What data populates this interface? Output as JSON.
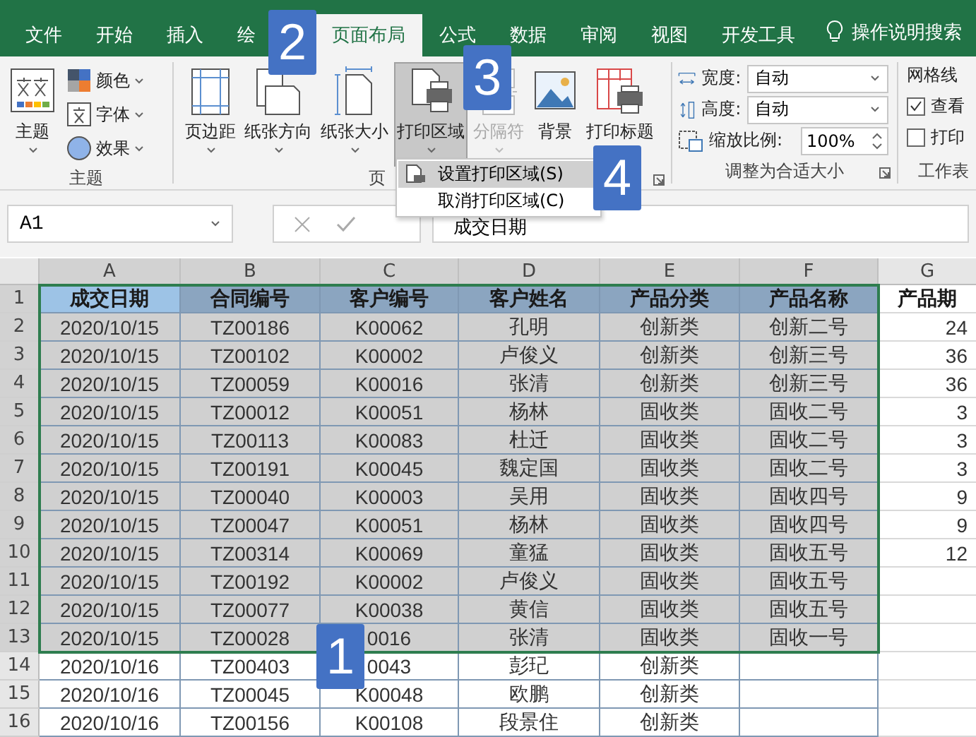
{
  "tabs": [
    {
      "label": "文件",
      "selected": false
    },
    {
      "label": "开始",
      "selected": false
    },
    {
      "label": "插入",
      "selected": false
    },
    {
      "label": "绘",
      "selected": false
    },
    {
      "label": "页面布局",
      "selected": true
    },
    {
      "label": "公式",
      "selected": false
    },
    {
      "label": "数据",
      "selected": false
    },
    {
      "label": "审阅",
      "selected": false
    },
    {
      "label": "视图",
      "selected": false
    },
    {
      "label": "开发工具",
      "selected": false
    }
  ],
  "tell_me": "操作说明搜索",
  "ribbon": {
    "theme_group": {
      "label": "主题",
      "main": "主题",
      "items": [
        "颜色",
        "字体",
        "效果"
      ]
    },
    "page_group": {
      "label": "页",
      "buttons": [
        {
          "label": "页边距",
          "kind": "margins",
          "selected": false,
          "disabled": false,
          "caret": true
        },
        {
          "label": "纸张方向",
          "kind": "orientation",
          "selected": false,
          "disabled": false,
          "caret": true
        },
        {
          "label": "纸张大小",
          "kind": "size",
          "selected": false,
          "disabled": false,
          "caret": true
        },
        {
          "label": "打印区域",
          "kind": "printarea",
          "selected": true,
          "disabled": false,
          "caret": true
        },
        {
          "label": "分隔符",
          "kind": "breaks",
          "selected": false,
          "disabled": true,
          "caret": true
        },
        {
          "label": "背景",
          "kind": "background",
          "selected": false,
          "disabled": false,
          "caret": false
        },
        {
          "label": "打印标题",
          "kind": "titles",
          "selected": false,
          "disabled": false,
          "caret": false
        }
      ]
    },
    "scale_group": {
      "label": "调整为合适大小",
      "width_label": "宽度:",
      "width_value": "自动",
      "height_label": "高度:",
      "height_value": "自动",
      "scale_label": "缩放比例:",
      "scale_value": "100%"
    },
    "sheet_group": {
      "label": "工作表",
      "heading": "网格线",
      "options": [
        {
          "label": "查看",
          "checked": true
        },
        {
          "label": "打印",
          "checked": false
        }
      ]
    }
  },
  "menu": {
    "items": [
      {
        "label": "设置打印区域(S)",
        "selected": true
      },
      {
        "label": "取消打印区域(C)",
        "selected": false
      }
    ]
  },
  "name_box": "A1",
  "formula": "成交日期",
  "columns": [
    {
      "label": "A",
      "selected": true
    },
    {
      "label": "B",
      "selected": true
    },
    {
      "label": "C",
      "selected": true
    },
    {
      "label": "D",
      "selected": true
    },
    {
      "label": "E",
      "selected": true
    },
    {
      "label": "F",
      "selected": true
    },
    {
      "label": "G",
      "selected": false
    }
  ],
  "rows": [
    {
      "number": "1",
      "kind": "header",
      "selected": true,
      "cells": [
        "成交日期",
        "合同编号",
        "客户编号",
        "客户姓名",
        "产品分类",
        "产品名称",
        "产品期"
      ]
    },
    {
      "number": "2",
      "kind": "data",
      "selected": true,
      "cells": [
        "2020/10/15",
        "TZ00186",
        "K00062",
        "孔明",
        "创新类",
        "创新二号",
        "24"
      ]
    },
    {
      "number": "3",
      "kind": "data",
      "selected": true,
      "cells": [
        "2020/10/15",
        "TZ00102",
        "K00002",
        "卢俊义",
        "创新类",
        "创新三号",
        "36"
      ]
    },
    {
      "number": "4",
      "kind": "data",
      "selected": true,
      "cells": [
        "2020/10/15",
        "TZ00059",
        "K00016",
        "张清",
        "创新类",
        "创新三号",
        "36"
      ]
    },
    {
      "number": "5",
      "kind": "data",
      "selected": true,
      "cells": [
        "2020/10/15",
        "TZ00012",
        "K00051",
        "杨林",
        "固收类",
        "固收二号",
        "3"
      ]
    },
    {
      "number": "6",
      "kind": "data",
      "selected": true,
      "cells": [
        "2020/10/15",
        "TZ00113",
        "K00083",
        "杜迁",
        "固收类",
        "固收二号",
        "3"
      ]
    },
    {
      "number": "7",
      "kind": "data",
      "selected": true,
      "cells": [
        "2020/10/15",
        "TZ00191",
        "K00045",
        "魏定国",
        "固收类",
        "固收二号",
        "3"
      ]
    },
    {
      "number": "8",
      "kind": "data",
      "selected": true,
      "cells": [
        "2020/10/15",
        "TZ00040",
        "K00003",
        "吴用",
        "固收类",
        "固收四号",
        "9"
      ]
    },
    {
      "number": "9",
      "kind": "data",
      "selected": true,
      "cells": [
        "2020/10/15",
        "TZ00047",
        "K00051",
        "杨林",
        "固收类",
        "固收四号",
        "9"
      ]
    },
    {
      "number": "10",
      "kind": "data",
      "selected": true,
      "cells": [
        "2020/10/15",
        "TZ00314",
        "K00069",
        "童猛",
        "固收类",
        "固收五号",
        "12"
      ]
    },
    {
      "number": "11",
      "kind": "data",
      "selected": true,
      "cells": [
        "2020/10/15",
        "TZ00192",
        "K00002",
        "卢俊义",
        "固收类",
        "固收五号"
      ]
    },
    {
      "number": "12",
      "kind": "data",
      "selected": true,
      "cells": [
        "2020/10/15",
        "TZ00077",
        "K00038",
        "黄信",
        "固收类",
        "固收五号"
      ]
    },
    {
      "number": "13",
      "kind": "data",
      "selected": true,
      "cells": [
        "2020/10/15",
        "TZ00028",
        "0016",
        "张清",
        "固收类",
        "固收一号"
      ]
    },
    {
      "number": "14",
      "kind": "data",
      "selected": false,
      "cells": [
        "2020/10/16",
        "TZ00403",
        "0043",
        "彭玘",
        "创新类"
      ]
    },
    {
      "number": "15",
      "kind": "data",
      "selected": false,
      "cells": [
        "2020/10/16",
        "TZ00045",
        "K00048",
        "欧鹏",
        "创新类"
      ]
    },
    {
      "number": "16",
      "kind": "data",
      "selected": false,
      "cells": [
        "2020/10/16",
        "TZ00156",
        "K00108",
        "段景住",
        "创新类"
      ]
    }
  ],
  "callouts": [
    {
      "label": "1",
      "kind": "cells"
    },
    {
      "label": "2",
      "kind": "tab"
    },
    {
      "label": "3",
      "kind": "button"
    },
    {
      "label": "4",
      "kind": "menu"
    }
  ]
}
